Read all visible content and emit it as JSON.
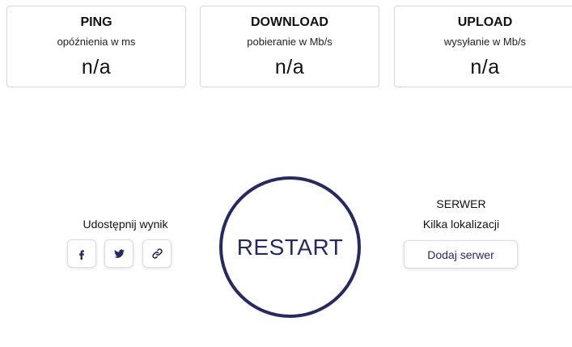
{
  "metrics": {
    "ping": {
      "title": "PING",
      "subtitle": "opóźnienia w ms",
      "value": "n/a"
    },
    "download": {
      "title": "DOWNLOAD",
      "subtitle": "pobieranie w Mb/s",
      "value": "n/a"
    },
    "upload": {
      "title": "UPLOAD",
      "subtitle": "wysyłanie w Mb/s",
      "value": "n/a"
    }
  },
  "share": {
    "label": "Udostępnij wynik",
    "buttons": [
      {
        "icon": "facebook-icon"
      },
      {
        "icon": "twitter-icon"
      },
      {
        "icon": "link-icon"
      }
    ]
  },
  "restart": {
    "label": "RESTART"
  },
  "server": {
    "title": "SERWER",
    "subtitle": "Kilka lokalizacji",
    "add_label": "Dodaj serwer"
  },
  "colors": {
    "accent": "#262a5e",
    "border": "#d7d7d7",
    "text": "#111111"
  }
}
